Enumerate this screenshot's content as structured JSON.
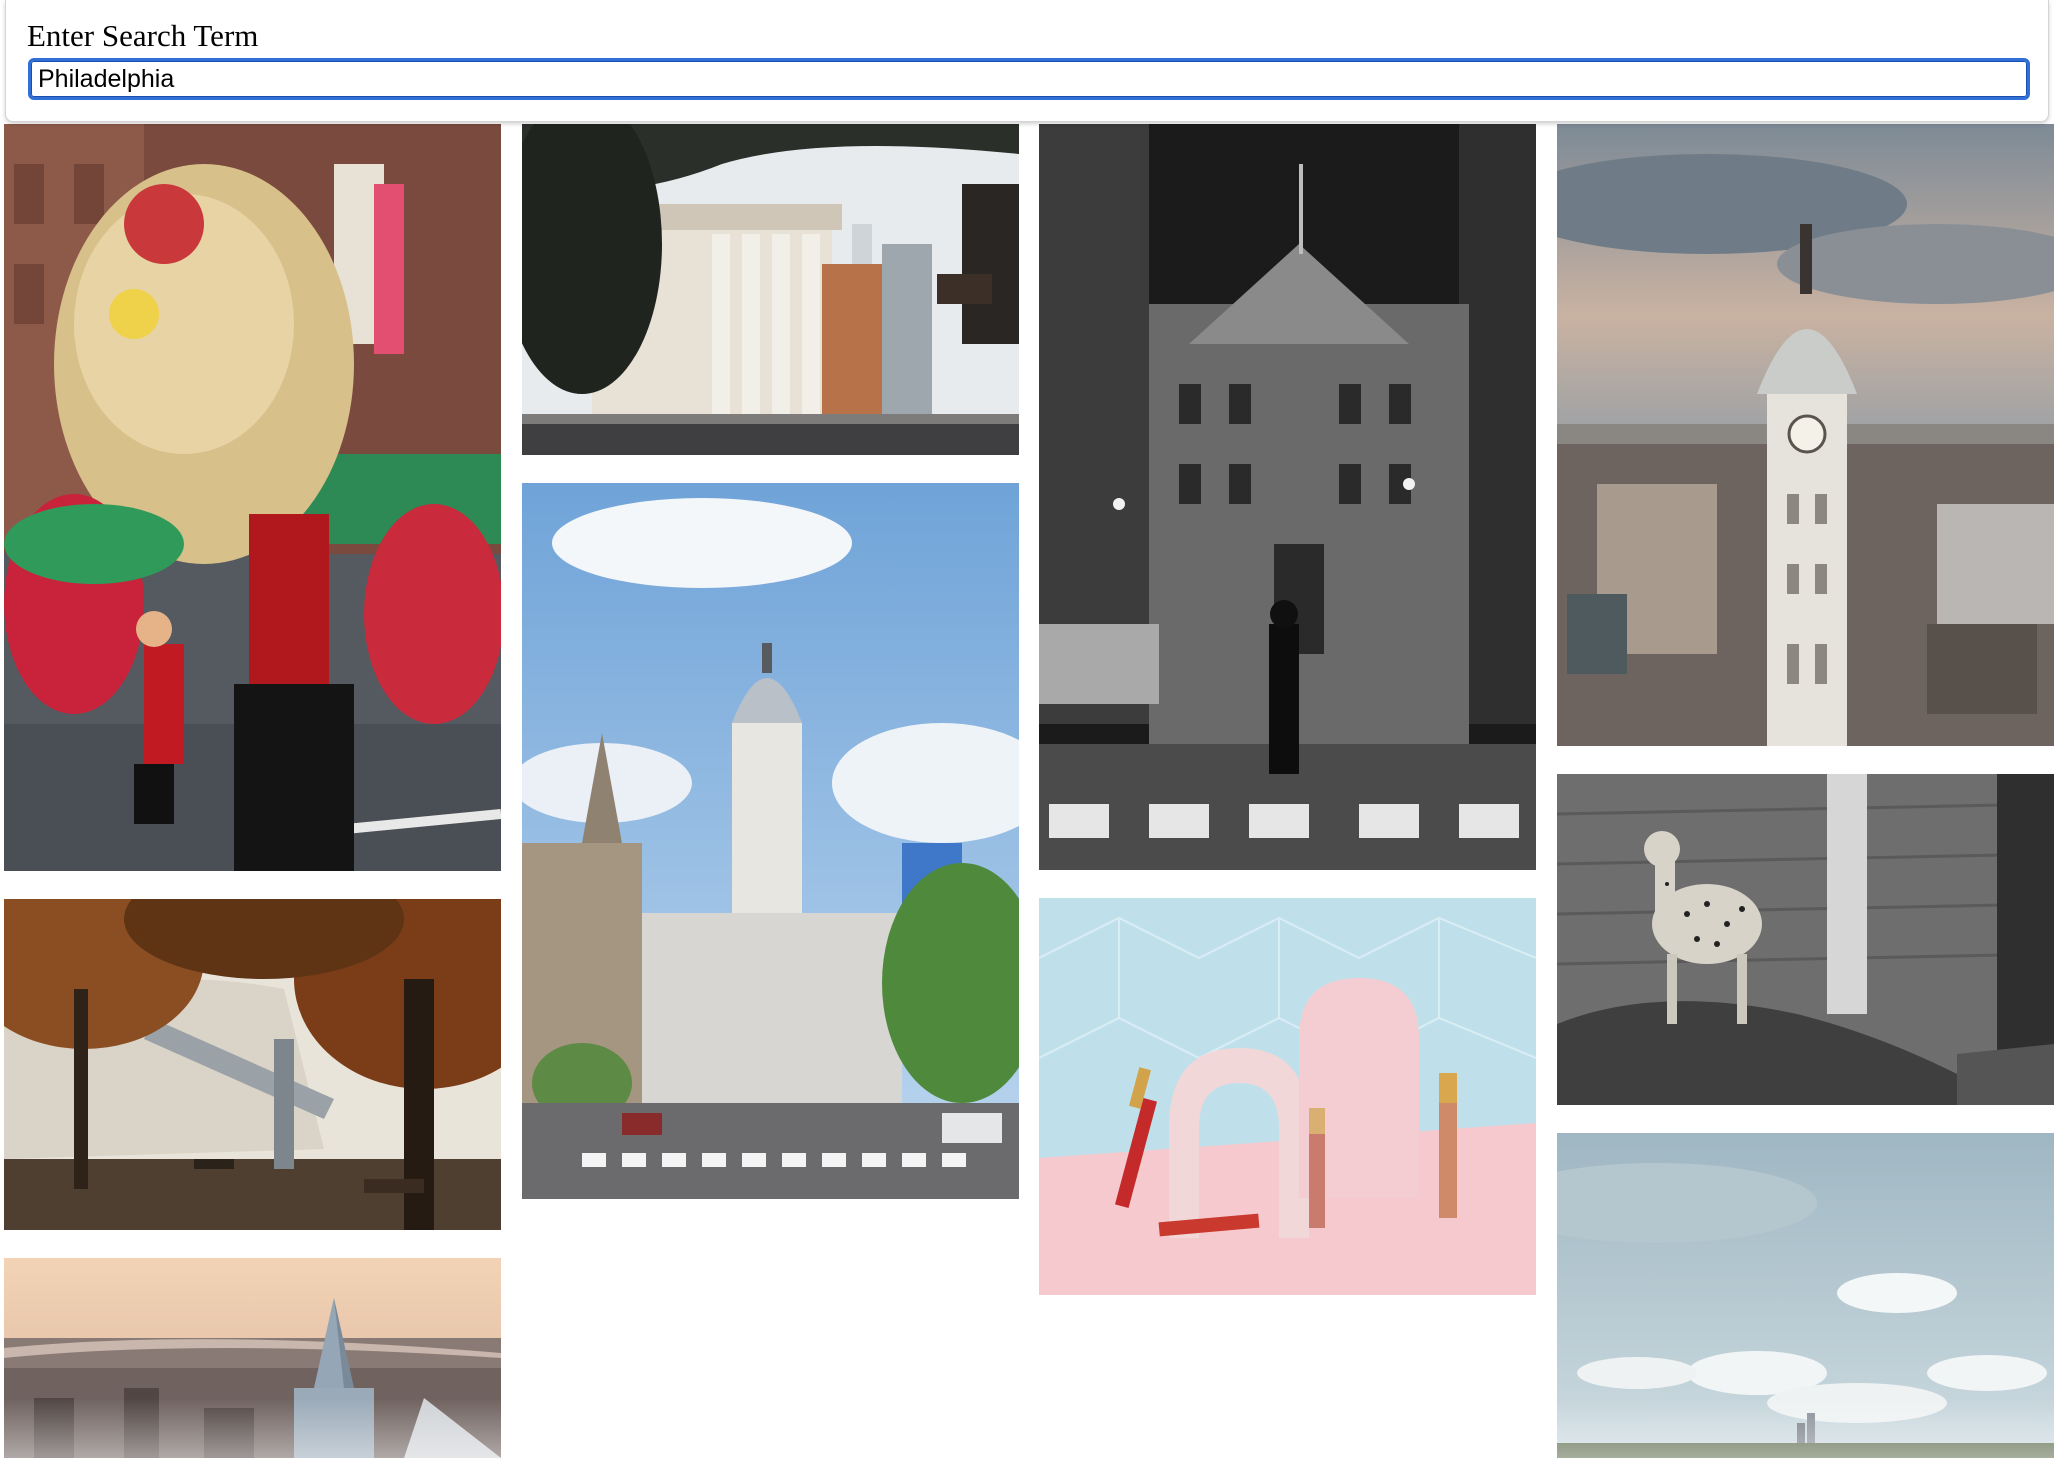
{
  "search": {
    "label": "Enter Search Term",
    "value": "Philadelphia",
    "accent_color": "#2f6fd6"
  },
  "gallery": {
    "images": [
      {
        "id": "chinatown-lion-dance",
        "subject": "lion dance parade",
        "tone": "color"
      },
      {
        "id": "autumn-bridge-park",
        "subject": "riverside park with bridge",
        "tone": "color"
      },
      {
        "id": "skyline-aerial-sunset",
        "subject": "aerial skyline at sunset",
        "tone": "color"
      },
      {
        "id": "city-street-columns",
        "subject": "street with columned building",
        "tone": "color"
      },
      {
        "id": "city-hall-avenue",
        "subject": "city hall tower down avenue",
        "tone": "color"
      },
      {
        "id": "city-hall-night-bw",
        "subject": "city hall at night crosswalk",
        "tone": "grayscale"
      },
      {
        "id": "lipstick-product",
        "subject": "lip gloss product shot",
        "tone": "color"
      },
      {
        "id": "city-hall-aerial",
        "subject": "city hall tower aerial",
        "tone": "color"
      },
      {
        "id": "cheetah-bw",
        "subject": "cheetah on rock",
        "tone": "grayscale"
      },
      {
        "id": "cloudy-skyline",
        "subject": "cloudy sky over skyline",
        "tone": "color"
      }
    ]
  }
}
